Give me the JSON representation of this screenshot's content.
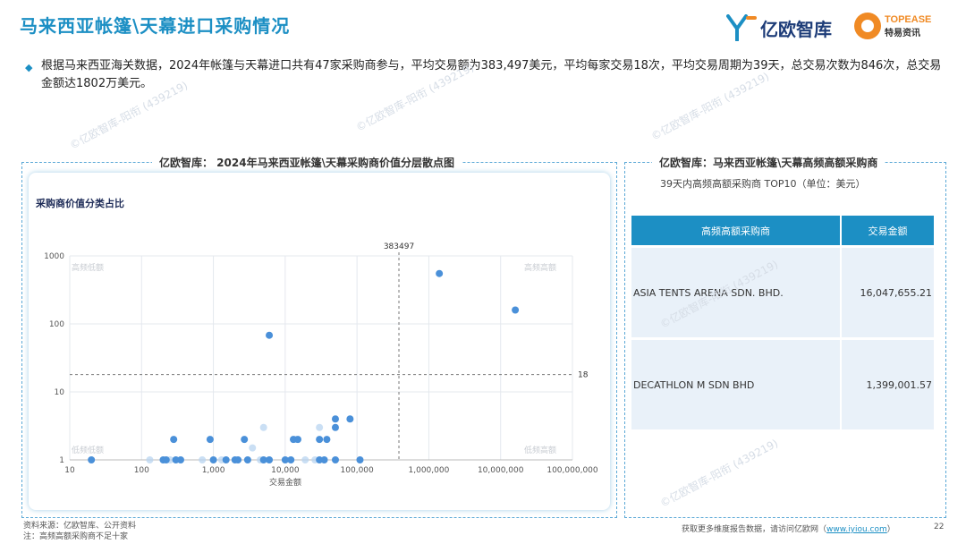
{
  "page": {
    "title": "马来西亚帐篷\\天幕进口采购情况",
    "summary": "根据马来西亚海关数据，2024年帐篷与天幕进口共有47家采购商参与，平均交易额为383,497美元，平均每家交易18次，平均交易周期为39天，总交易次数为846次，总交易金额达1802万美元。",
    "logo_yiou": "亿欧智库",
    "logo_topease_en": "TOPEASE",
    "logo_topease_cn": "特易资讯",
    "watermark": "©亿欧智库-阳衔 (439219)"
  },
  "left_panel": {
    "title": "亿欧智库： 2024年马来西亚帐篷\\天幕采购商价值分层散点图",
    "card_title": "采购商价值分类占比"
  },
  "chart_data": {
    "type": "scatter",
    "xlabel": "交易金额",
    "ylabel": "",
    "x_scale": "log",
    "y_scale": "log",
    "xlim": [
      10,
      100000000
    ],
    "ylim": [
      1,
      1000
    ],
    "x_ticks": [
      {
        "value": 10,
        "label": "10"
      },
      {
        "value": 100,
        "label": "100"
      },
      {
        "value": 1000,
        "label": "1,000"
      },
      {
        "value": 10000,
        "label": "10,000"
      },
      {
        "value": 100000,
        "label": "100,000"
      },
      {
        "value": 1000000,
        "label": "1,000,000"
      },
      {
        "value": 10000000,
        "label": "10,000,000"
      },
      {
        "value": 100000000,
        "label": "100,000,000"
      }
    ],
    "y_ticks": [
      {
        "value": 1,
        "label": "1"
      },
      {
        "value": 10,
        "label": "10"
      },
      {
        "value": 100,
        "label": "100"
      },
      {
        "value": 1000,
        "label": "1000"
      }
    ],
    "reference_lines": [
      {
        "axis": "x",
        "value": 383497,
        "label": "383497"
      },
      {
        "axis": "y",
        "value": 18,
        "label": "18"
      }
    ],
    "quadrant_labels": [
      "高频低额",
      "高频高额",
      "低频低额",
      "低频高额"
    ],
    "grid": true,
    "points": [
      {
        "x": 20,
        "y": 1
      },
      {
        "x": 200,
        "y": 1
      },
      {
        "x": 220,
        "y": 1
      },
      {
        "x": 300,
        "y": 1
      },
      {
        "x": 350,
        "y": 1
      },
      {
        "x": 1000,
        "y": 1
      },
      {
        "x": 1500,
        "y": 1
      },
      {
        "x": 2000,
        "y": 1
      },
      {
        "x": 2200,
        "y": 1
      },
      {
        "x": 3000,
        "y": 1
      },
      {
        "x": 5000,
        "y": 1
      },
      {
        "x": 6000,
        "y": 1
      },
      {
        "x": 10000,
        "y": 1
      },
      {
        "x": 12000,
        "y": 1
      },
      {
        "x": 30000,
        "y": 1
      },
      {
        "x": 35000,
        "y": 1
      },
      {
        "x": 50000,
        "y": 1
      },
      {
        "x": 110000,
        "y": 1
      },
      {
        "x": 280,
        "y": 2
      },
      {
        "x": 900,
        "y": 2
      },
      {
        "x": 2700,
        "y": 2
      },
      {
        "x": 13000,
        "y": 2
      },
      {
        "x": 15000,
        "y": 2
      },
      {
        "x": 30000,
        "y": 2
      },
      {
        "x": 38000,
        "y": 2
      },
      {
        "x": 50000,
        "y": 3
      },
      {
        "x": 50000,
        "y": 4
      },
      {
        "x": 80000,
        "y": 4
      },
      {
        "x": 6000,
        "y": 68
      },
      {
        "x": 1400000,
        "y": 550
      },
      {
        "x": 16000000,
        "y": 160
      }
    ],
    "faint_points": [
      {
        "x": 130,
        "y": 1
      },
      {
        "x": 250,
        "y": 1
      },
      {
        "x": 700,
        "y": 1
      },
      {
        "x": 1300,
        "y": 1
      },
      {
        "x": 4500,
        "y": 1
      },
      {
        "x": 19000,
        "y": 1
      },
      {
        "x": 26000,
        "y": 1
      },
      {
        "x": 3500,
        "y": 1.5
      },
      {
        "x": 5000,
        "y": 3
      },
      {
        "x": 14000,
        "y": 2
      },
      {
        "x": 30000,
        "y": 3
      }
    ],
    "point_color": "#4a90d9",
    "faint_color": "#b8d4f0"
  },
  "right_panel": {
    "title": "亿欧智库：马来西亚帐篷\\天幕高频高额采购商",
    "subtitle": "39天内高频高额采购商 TOP10（单位：美元）",
    "headers": [
      "高频高额采购商",
      "交易金额"
    ],
    "rows": [
      {
        "name": "ASIA TENTS ARENA SDN. BHD.",
        "amount": "16,047,655.21"
      },
      {
        "name": "DECATHLON M SDN BHD",
        "amount": "1,399,001.57"
      }
    ]
  },
  "footer": {
    "source": "资料来源：亿欧智库、公开资料",
    "note": "注：高频高额采购商不足十家",
    "more_text": "获取更多维度报告数据，请访问亿欧网（",
    "link": "www.iyiou.com",
    "close_paren": "）",
    "page_number": "22"
  }
}
